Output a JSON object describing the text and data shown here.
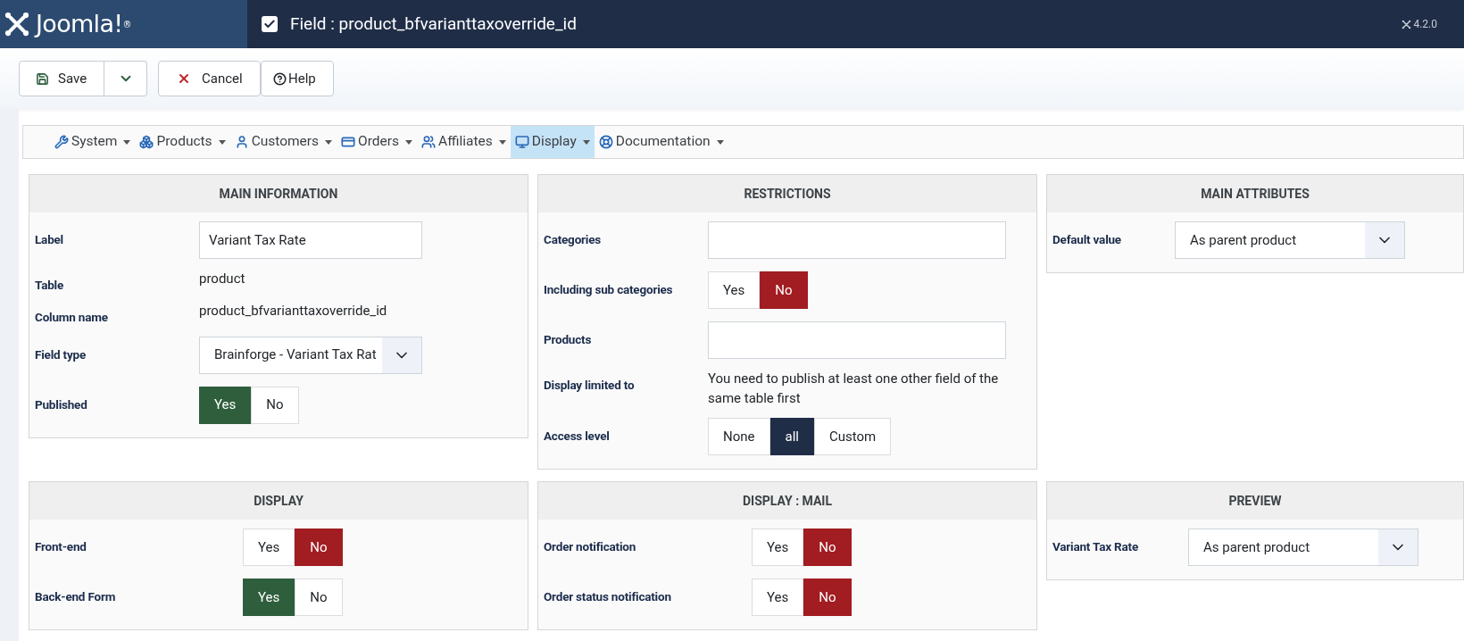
{
  "header": {
    "logo": "Joomla!$^{®}$",
    "title": "Field : product_bfvarianttaxoverride_id",
    "version": "4.2.0"
  },
  "toolbar": [
    {
      "kind": "save",
      "label": "Save"
    },
    {
      "kind": "caret"
    },
    {
      "kind": "cancel",
      "label": "Cancel"
    },
    {
      "kind": "help",
      "label": "Help"
    }
  ],
  "menu": [
    {
      "label": "System",
      "selected": false
    },
    {
      "label": "Products",
      "selected": false
    },
    {
      "label": "Customers",
      "selected": false
    },
    {
      "label": "Orders",
      "selected": false
    },
    {
      "label": "Affiliates",
      "selected": false
    },
    {
      "label": "Display",
      "selected": true
    },
    {
      "label": "Documentation",
      "selected": false
    }
  ],
  "panels": [
    {
      "title": "MAIN INFORMATION",
      "rows": [
        {
          "kind": "input",
          "label": "Label",
          "value": "Variant Tax Rate"
        },
        {
          "kind": "text",
          "label": "Table",
          "value": "product"
        },
        {
          "kind": "text",
          "label": "Column name",
          "value": "product_bfvarianttaxoverride_id"
        },
        {
          "kind": "select",
          "label": "Field type",
          "value": "Brainforge - Variant Tax Rat"
        },
        {
          "kind": "toggle",
          "label": "Published",
          "options": [
            {
              "label": "Yes",
              "selected": true
            },
            {
              "label": "No",
              "selected": false
            }
          ]
        }
      ]
    },
    {
      "title": "RESTRICTIONS",
      "rows": [
        {
          "kind": "input",
          "label": "Categories",
          "value": ""
        },
        {
          "kind": "toggle",
          "label": "Including sub categories",
          "options": [
            {
              "label": "Yes",
              "selected": false
            },
            {
              "label": "No",
              "selected": true
            }
          ]
        },
        {
          "kind": "input",
          "label": "Products",
          "value": ""
        },
        {
          "kind": "text",
          "label": "Display limited to",
          "value": "You need to publish at least one other field of the same table first"
        },
        {
          "kind": "choice",
          "label": "Access level",
          "options": [
            {
              "label": "None",
              "selected": false
            },
            {
              "label": "all",
              "selected": true
            },
            {
              "label": "Custom",
              "selected": false
            }
          ]
        }
      ]
    },
    {
      "title": "MAIN ATTRIBUTES",
      "rows": [
        {
          "kind": "select",
          "label": "Default value",
          "value": "As parent product"
        }
      ]
    },
    {
      "title": "DISPLAY",
      "rows": [
        {
          "kind": "toggle",
          "label": "Front-end",
          "options": [
            {
              "label": "Yes",
              "selected": false
            },
            {
              "label": "No",
              "selected": true
            }
          ]
        },
        {
          "kind": "toggle",
          "label": "Back-end Form",
          "options": [
            {
              "label": "Yes",
              "selected": true
            },
            {
              "label": "No",
              "selected": false
            }
          ]
        }
      ]
    },
    {
      "title": "DISPLAY : MAIL",
      "rows": [
        {
          "kind": "toggle",
          "label": "Order notification",
          "options": [
            {
              "label": "Yes",
              "selected": false
            },
            {
              "label": "No",
              "selected": true
            }
          ]
        },
        {
          "kind": "toggle",
          "label": "Order status notification",
          "options": [
            {
              "label": "Yes",
              "selected": false
            },
            {
              "label": "No",
              "selected": true
            }
          ]
        }
      ]
    },
    {
      "title": "PREVIEW",
      "rows": [
        {
          "kind": "select",
          "label": "Variant Tax Rate",
          "value": "As parent product"
        }
      ]
    }
  ]
}
